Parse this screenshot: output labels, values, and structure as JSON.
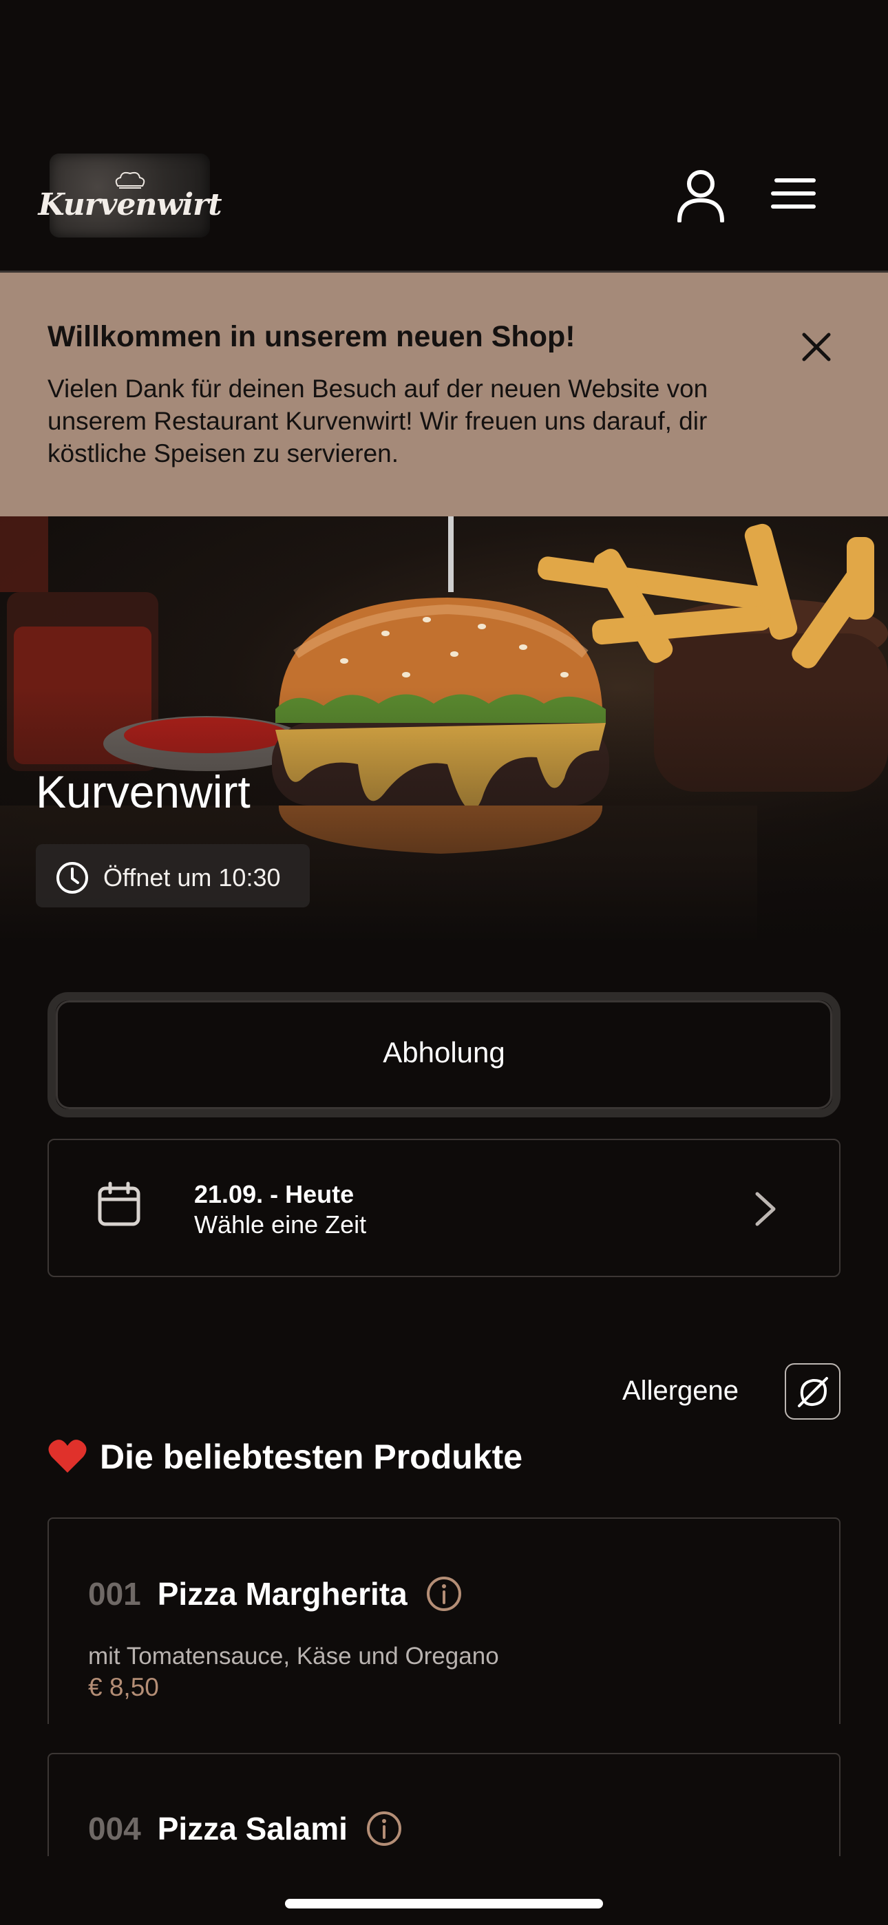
{
  "header": {
    "logo_text": "Kurvenwirt",
    "icons": {
      "user": "user-icon",
      "menu": "menu-icon"
    }
  },
  "banner": {
    "title": "Willkommen in unserem neuen Shop!",
    "text": "Vielen Dank für deinen Besuch auf der neuen Website von unserem Restaurant Kurvenwirt! Wir freuen uns darauf, dir köstliche Speisen zu servieren.",
    "close_icon": "close-icon",
    "background": "#a58a79"
  },
  "hero": {
    "title": "Kurvenwirt",
    "status": "Öffnet um 10:30",
    "status_icon": "clock-icon"
  },
  "order": {
    "mode_label": "Abholung",
    "date_title": "21.09. - Heute",
    "date_sub": "Wähle eine Zeit"
  },
  "filters": {
    "allergen_label": "Allergene"
  },
  "section": {
    "title": "Die beliebtesten Produkte"
  },
  "products": [
    {
      "number": "001",
      "name": "Pizza Margherita",
      "description": "mit Tomatensauce, Käse und Oregano",
      "price": "€ 8,50"
    },
    {
      "number": "004",
      "name": "Pizza Salami"
    }
  ],
  "colors": {
    "accent": "#b48e76",
    "background": "#0e0b0a"
  }
}
